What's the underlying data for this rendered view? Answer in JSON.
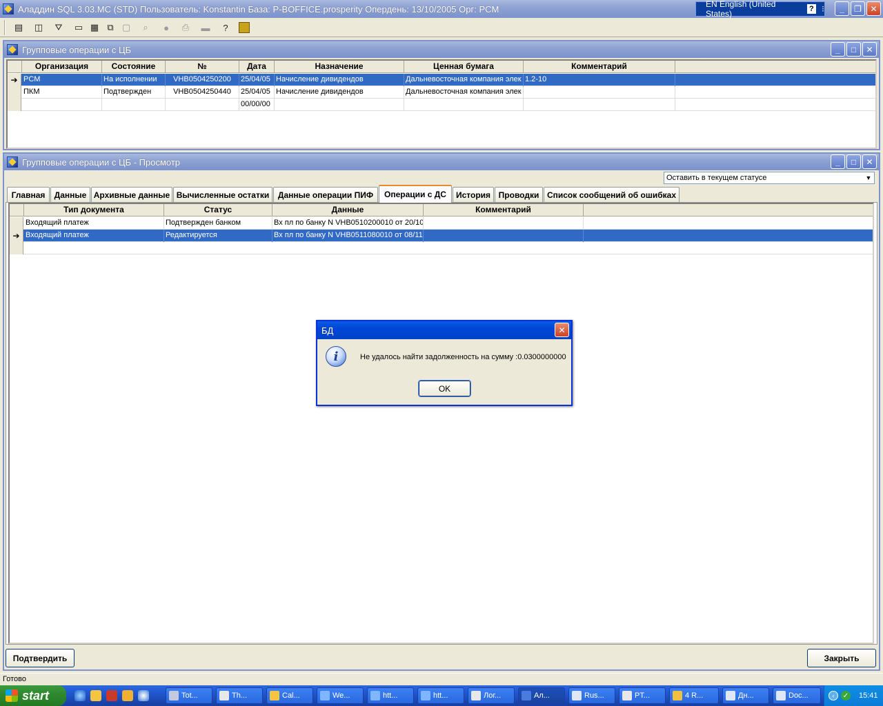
{
  "app": {
    "title": "Аладдин SQL 3.03.MC (STD)  Пользователь: Konstantin База: P-BOFFICE.prosperity Опердень: 13/10/2005 Орг: PCM",
    "language": "EN English (United States)"
  },
  "window1": {
    "title": "Групповые операции с ЦБ",
    "columns": [
      "Организация",
      "Состояние",
      "№",
      "Дата",
      "Назначение",
      "Ценная бумага",
      "Комментарий"
    ],
    "rows": [
      [
        "PCM",
        "На исполнении",
        "VHB0504250200",
        "25/04/05",
        "Начисление дивидендов",
        "Дальневосточная компания элек",
        "1.2-10"
      ],
      [
        "ПКМ",
        "Подтвержден",
        "VHB0504250440",
        "25/04/05",
        "Начисление дивидендов",
        "Дальневосточная компания элек",
        ""
      ],
      [
        "",
        "",
        "",
        "00/00/00",
        "",
        "",
        ""
      ]
    ]
  },
  "window2": {
    "title": "Групповые операции с ЦБ - Просмотр",
    "status_select": "Оставить в текущем статусе",
    "tabs": [
      "Главная",
      "Данные",
      "Архивные данные",
      "Вычисленные остатки",
      "Данные операции ПИФ",
      "Операции с ДС",
      "История",
      "Проводки",
      "Список сообщений об ошибках"
    ],
    "active_tab": "Операции с ДС",
    "columns": [
      "Тип документа",
      "Статус",
      "Данные",
      "Комментарий"
    ],
    "rows": [
      [
        "Входящий платеж",
        "Подтвержден банком",
        "Вх пл по банку N VHB0510200010 от 20/10",
        ""
      ],
      [
        "Входящий платеж",
        "Редактируется",
        "Вх пл по банку N VHB0511080010 от 08/11",
        ""
      ]
    ],
    "confirm_button": "Подтвердить",
    "close_button": "Закрыть"
  },
  "dialog": {
    "title": "БД",
    "message": "Не удалось найти задолженность на сумму :0.0300000000",
    "ok": "OK"
  },
  "statusbar": {
    "text": "Готово"
  },
  "taskbar": {
    "start": "start",
    "tasks": [
      "Tot...",
      "Th...",
      "Cal...",
      "We...",
      "htt...",
      "htt...",
      "Лог...",
      "Ал...",
      "Rus...",
      "PT...",
      "4 R...",
      "Дн...",
      "Doc..."
    ],
    "clock": "15:41"
  }
}
